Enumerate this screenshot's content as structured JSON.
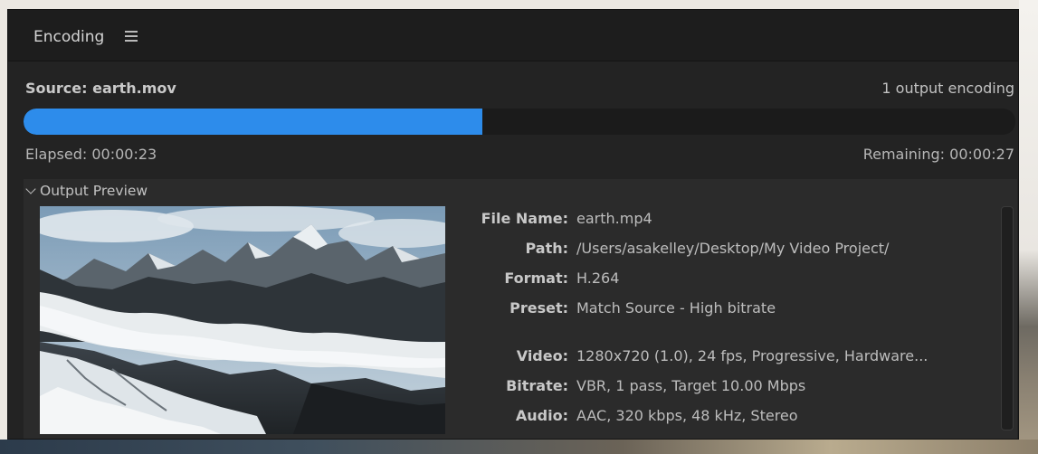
{
  "panel": {
    "title": "Encoding",
    "menu_icon": "hamburger-menu-icon"
  },
  "source": {
    "label": "Source: earth.mov",
    "outputs": "1 output encoding"
  },
  "progress": {
    "fraction": 0.463,
    "elapsed": "Elapsed: 00:00:23",
    "remaining": "Remaining: 00:00:27",
    "color": "#2d8ceb"
  },
  "preview": {
    "toggle_label": "Output Preview",
    "toggle_icon": "chevron-down-icon",
    "thumbnail": "mountain-clouds-thumbnail"
  },
  "details": [
    {
      "key": "File Name:",
      "value": "earth.mp4"
    },
    {
      "key": "Path:",
      "value": "/Users/asakelley/Desktop/My Video Project/"
    },
    {
      "key": "Format:",
      "value": "H.264"
    },
    {
      "key": "Preset:",
      "value": "Match Source - High bitrate"
    },
    {
      "key": "Video:",
      "value": "1280x720 (1.0), 24 fps, Progressive, Hardware..."
    },
    {
      "key": "Bitrate:",
      "value": "VBR, 1 pass, Target 10.00 Mbps"
    },
    {
      "key": "Audio:",
      "value": "AAC, 320 kbps, 48 kHz, Stereo"
    }
  ]
}
